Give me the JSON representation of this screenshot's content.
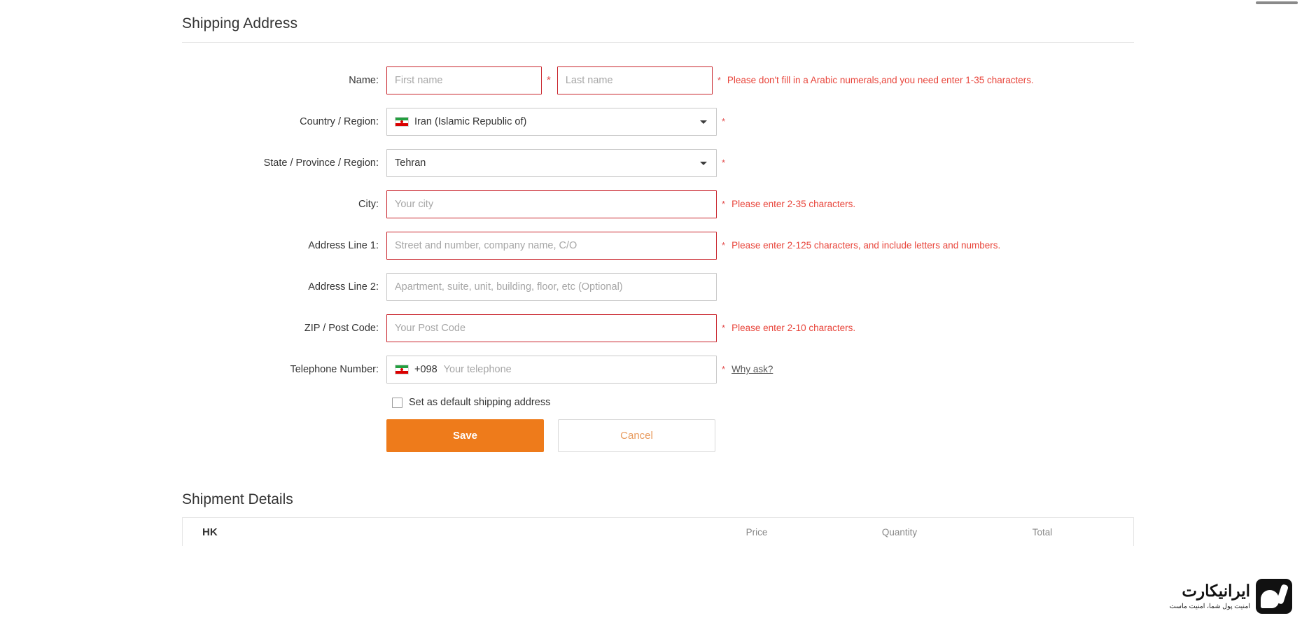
{
  "section": {
    "shipping_title": "Shipping Address",
    "shipment_title": "Shipment Details"
  },
  "form": {
    "name": {
      "label": "Name:",
      "first_placeholder": "First name",
      "first_value": "",
      "last_placeholder": "Last name",
      "last_value": "",
      "required_mark": "*",
      "hint": "Please don't fill in a Arabic numerals,and you need enter 1-35 characters."
    },
    "country": {
      "label": "Country / Region:",
      "value": "Iran (Islamic Republic of)",
      "flag": "iran-flag",
      "required_mark": "*"
    },
    "state": {
      "label": "State / Province / Region:",
      "value": "Tehran",
      "required_mark": "*"
    },
    "city": {
      "label": "City:",
      "placeholder": "Your city",
      "value": "",
      "required_mark": "*",
      "hint": "Please enter 2-35 characters."
    },
    "address1": {
      "label": "Address Line 1:",
      "placeholder": "Street and number, company name, C/O",
      "value": "",
      "required_mark": "*",
      "hint": "Please enter 2-125 characters, and include letters and numbers."
    },
    "address2": {
      "label": "Address Line 2:",
      "placeholder": "Apartment, suite, unit, building, floor, etc (Optional)",
      "value": ""
    },
    "zip": {
      "label": "ZIP / Post Code:",
      "placeholder": "Your Post Code",
      "value": "",
      "required_mark": "*",
      "hint": "Please enter 2-10 characters."
    },
    "telephone": {
      "label": "Telephone Number:",
      "dial_code": "+098",
      "placeholder": "Your telephone",
      "value": "",
      "required_mark": "*",
      "why_ask": "Why ask?"
    },
    "default_checkbox": {
      "label": "Set as default shipping address",
      "checked": false
    },
    "buttons": {
      "save": "Save",
      "cancel": "Cancel"
    }
  },
  "shipment_table": {
    "columns": [
      "HK",
      "Price",
      "Quantity",
      "Total"
    ]
  },
  "logo": {
    "name": "ایرانیکارت",
    "tagline": "امنیت پول شما، امنیت ماست"
  },
  "colors": {
    "accent_orange": "#ee7b1b",
    "error_red": "#e8443a",
    "border_red": "#c9252d",
    "border_gray": "#c9c9c9",
    "text": "#333333"
  }
}
